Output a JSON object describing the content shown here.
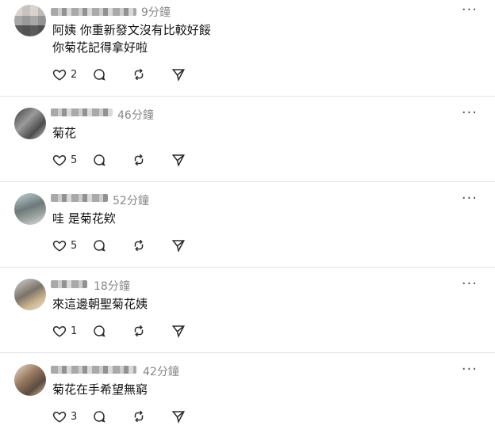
{
  "posts": [
    {
      "time": "9分鐘",
      "lines": [
        "阿姨 你重新發文沒有比較好餒",
        "你菊花記得拿好啦"
      ],
      "likes": "2"
    },
    {
      "time": "46分鐘",
      "lines": [
        "菊花"
      ],
      "likes": "5"
    },
    {
      "time": "52分鐘",
      "lines": [
        "哇 是菊花欸"
      ],
      "likes": "5"
    },
    {
      "time": "18分鐘",
      "lines": [
        "來這邊朝聖菊花姨"
      ],
      "likes": "1"
    },
    {
      "time": "42分鐘",
      "lines": [
        "菊花在手希望無窮"
      ],
      "likes": "3"
    }
  ],
  "more_label": "···",
  "icons": [
    "heart-icon",
    "comment-icon",
    "repost-icon",
    "share-icon"
  ]
}
